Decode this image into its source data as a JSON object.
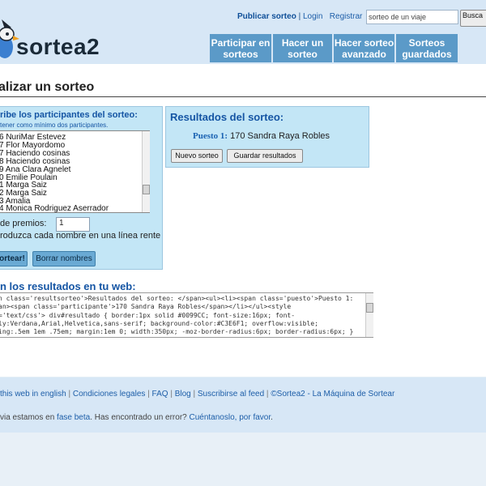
{
  "header": {
    "logo_text": "sortea",
    "logo_num": "2",
    "toplinks": {
      "publish": "Publicar sorteo",
      "sep1": " | ",
      "login": "Login",
      "sep2": "   ",
      "register": "Registrar"
    },
    "search": {
      "value": "sorteo de un viaje",
      "button": "Busca"
    },
    "nav": [
      {
        "label": "Participar en sorteos"
      },
      {
        "label": "Hacer un sorteo"
      },
      {
        "label": "Hacer sorteo avanzado"
      },
      {
        "label": "Sorteos guardados"
      }
    ]
  },
  "page": {
    "title": "alizar un sorteo"
  },
  "participants": {
    "title": "ribe los participantes del sorteo:",
    "subtitle": "tener como mínimo dos participantes.",
    "names": [
      "6   NuriMar Estevez",
      "7   Flor Mayordomo",
      "7   Haciendo cosinas",
      "8   Haciendo cosinas",
      "9   Ana Clara Agnelet",
      "0   Emilie Poulain",
      "1   Marga Saiz",
      "2   Marga Saiz",
      "3   Amalia",
      "4   Monica Rodriguez Aserrador"
    ],
    "prizes_label": "de premios:",
    "prizes_value": "1",
    "hint": "roduzca cada nombre en una línea rente",
    "sortear_button": "ortear!",
    "borrar_button": "Borrar nombres"
  },
  "results": {
    "title": "Resultados del sorteo:",
    "puesto_label": "Puesto 1:",
    "winner": "170 Sandra Raya Robles",
    "nuevo_button": "Nuevo sorteo",
    "guardar_button": "Guardar resultados"
  },
  "embed": {
    "title": "n los resultados en tu web:",
    "code_lines": [
      "n class='resultsorteo'>Resultados del sorteo: </span><ul><li><span class='puesto'>Puesto 1:",
      "an><span class='participante'>170   Sandra Raya Robles</span></li></ul><style",
      "='text/css'> div#resultado { border:1px solid #0099CC; font-size:16px; font-",
      "ly:Verdana,Arial,Helvetica,sans-serif; background-color:#C3E6F1; overflow:visible;",
      "ing:.5em 1em .75em; margin:1em 0; width:350px; -moz-border-radius:6px; border-radius:6px; }"
    ]
  },
  "footer": {
    "links": [
      "this web in english",
      "Condiciones legales",
      "FAQ",
      "Blog",
      "Suscribirse al feed",
      "©Sortea2 - La Máquina de Sortear"
    ],
    "separator": " | ",
    "note_prefix": "via estamos en ",
    "note_link1": "fase beta",
    "note_middle": ". Has encontrado un error? ",
    "note_link2": "Cuéntanoslo, por favor",
    "note_suffix": "."
  }
}
